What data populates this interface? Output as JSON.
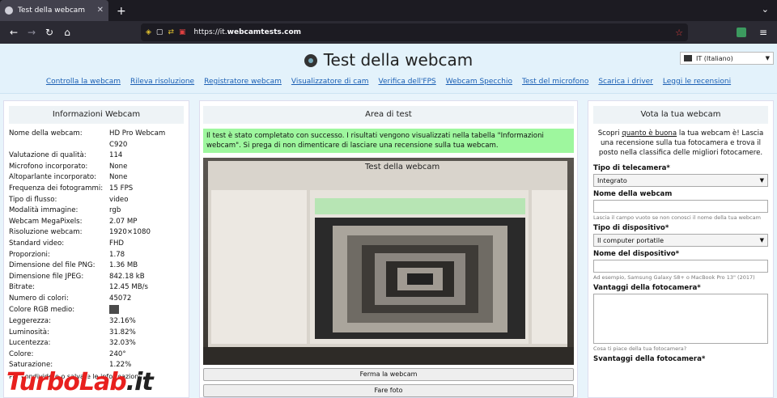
{
  "browser": {
    "tab_title": "Test della webcam",
    "close_glyph": "✕",
    "newtab_glyph": "+",
    "tabs_menu_glyph": "⌄",
    "back_glyph": "←",
    "forward_glyph": "→",
    "reload_glyph": "↻",
    "home_glyph": "⌂",
    "url_prefix": "https://it.",
    "url_domain": "webcamtests.com",
    "star_glyph": "☆",
    "menu_glyph": "≡"
  },
  "header": {
    "title": "Test della webcam",
    "language": "IT (Italiano)",
    "menu": [
      "Controlla la webcam",
      "Rileva risoluzione",
      "Registratore webcam",
      "Visualizzatore di cam",
      "Verifica dell'FPS",
      "Webcam Specchio",
      "Test del microfono",
      "Scarica i driver",
      "Leggi le recensioni"
    ]
  },
  "left": {
    "title": "Informazioni Webcam",
    "rows": [
      {
        "k": "Nome della webcam:",
        "v": "HD Pro Webcam"
      },
      {
        "k": "",
        "v": "C920"
      },
      {
        "k": "Valutazione di qualità:",
        "v": "114"
      },
      {
        "k": "Microfono incorporato:",
        "v": "None"
      },
      {
        "k": "Altoparlante incorporato:",
        "v": "None"
      },
      {
        "k": "Frequenza dei fotogrammi:",
        "v": "15 FPS"
      },
      {
        "k": "Tipo di flusso:",
        "v": "video"
      },
      {
        "k": "Modalità immagine:",
        "v": "rgb"
      },
      {
        "k": "Webcam MegaPixels:",
        "v": "2.07 MP"
      },
      {
        "k": "Risoluzione webcam:",
        "v": "1920×1080"
      },
      {
        "k": "Standard video:",
        "v": "FHD"
      },
      {
        "k": "Proporzioni:",
        "v": "1.78"
      },
      {
        "k": "Dimensione del file PNG:",
        "v": "1.36 MB"
      },
      {
        "k": "Dimensione file JPEG:",
        "v": "842.18 kB"
      },
      {
        "k": "Bitrate:",
        "v": "12.45 MB/s"
      },
      {
        "k": "Numero di colori:",
        "v": "45072"
      },
      {
        "k": "Colore RGB medio:",
        "v": ""
      },
      {
        "k": "Leggerezza:",
        "v": "32.16%"
      },
      {
        "k": "Luminosità:",
        "v": "31.82%"
      },
      {
        "k": "Lucentezza:",
        "v": "32.03%"
      },
      {
        "k": "Colore:",
        "v": "240°"
      },
      {
        "k": "Saturazione:",
        "v": "1.22%"
      }
    ],
    "rgb_color": "#4b4b4b",
    "footer": "Per condividere o salvare le informazioni"
  },
  "middle": {
    "title": "Area di test",
    "success": "Il test è stato completato con successo. I risultati vengono visualizzati nella tabella \"Informazioni webcam\". Si prega di non dimenticare di lasciare una recensione sulla tua webcam.",
    "stop_button": "Ferma la webcam",
    "second_button": "Fare foto"
  },
  "right": {
    "title": "Vota la tua webcam",
    "intro_before": "Scopri ",
    "intro_link": "quanto è buona",
    "intro_after": " la tua webcam è! Lascia una recensione sulla tua fotocamera e trova il posto nella classifica delle migliori fotocamere.",
    "camera_type_label": "Tipo di telecamera*",
    "camera_type_value": "Integrato",
    "webcam_name_label": "Nome della webcam",
    "webcam_name_hint": "Lascia il campo vuoto se non conosci il nome della tua webcam",
    "device_type_label": "Tipo di dispositivo*",
    "device_type_value": "Il computer portatile",
    "device_name_label": "Nome del dispositivo*",
    "device_name_hint": "Ad esempio, Samsung Galaxy S8+ o MacBook Pro 13\" (2017)",
    "advantages_label": "Vantaggi della fotocamera*",
    "advantages_hint": "Cosa ti piace della tua fotocamera?",
    "disadvantages_label": "Svantaggi della fotocamera*"
  },
  "watermark": {
    "brand": "TurboLab",
    "tld": ".it"
  }
}
